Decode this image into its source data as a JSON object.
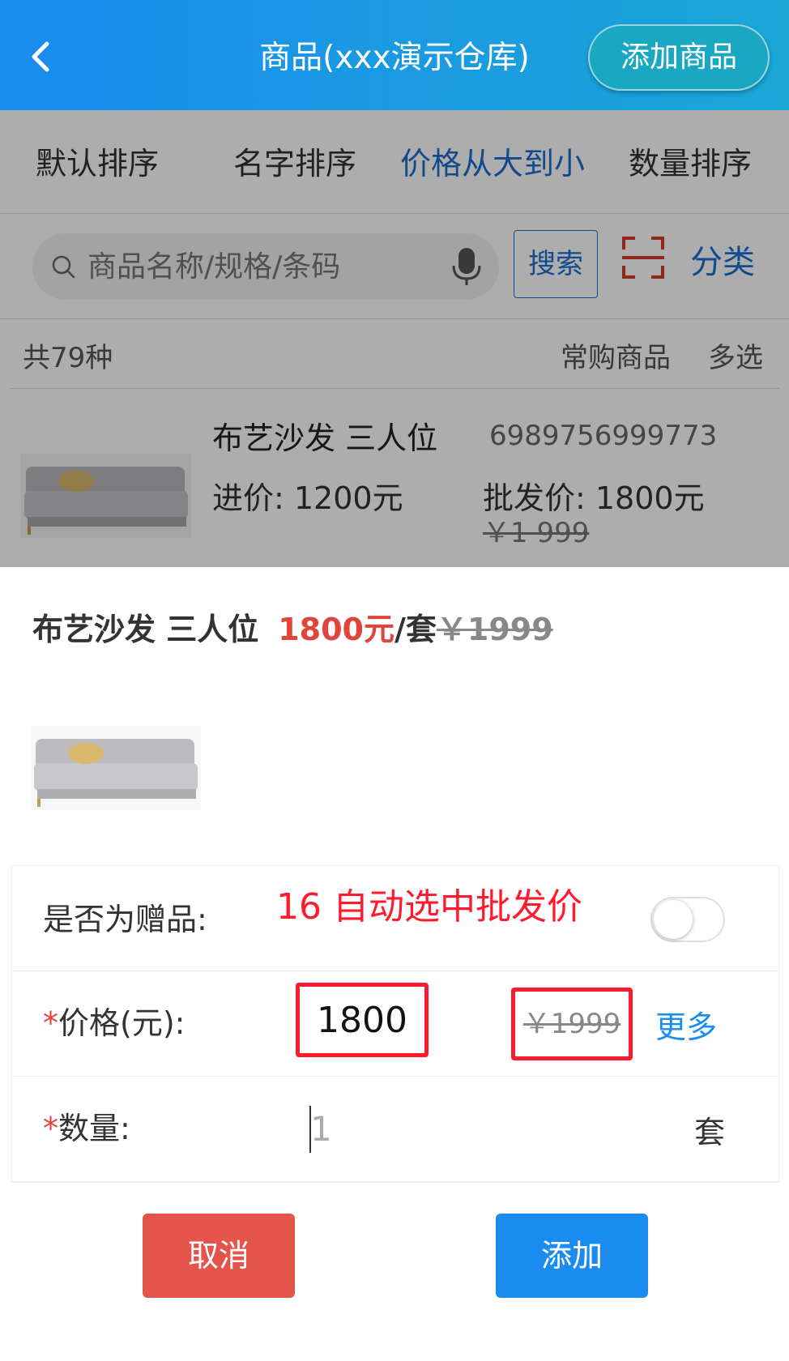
{
  "header": {
    "title": "商品(xxx演示仓库)",
    "add_button": "添加商品"
  },
  "sort_tabs": [
    {
      "label": "默认排序",
      "active": false
    },
    {
      "label": "名字排序",
      "active": false
    },
    {
      "label": "价格从大到小",
      "active": true
    },
    {
      "label": "数量排序",
      "active": false
    }
  ],
  "search": {
    "placeholder": "商品名称/规格/条码",
    "button": "搜索",
    "category": "分类"
  },
  "list_meta": {
    "count": "共79种",
    "often_bought": "常购商品",
    "multi_select": "多选"
  },
  "product": {
    "name": "布艺沙发   三人位",
    "barcode": "6989756999773",
    "cost_price": "进价: 1200元",
    "wholesale_price": "批发价: 1800元",
    "original_price": "￥1 999"
  },
  "popup": {
    "name": "布艺沙发   三人位",
    "price": "1800元",
    "unit_suffix": "/套",
    "original_price": "￥1999",
    "annotation": "16 自动选中批发价",
    "gift_label": "是否为赠品:",
    "gift_enabled": false,
    "price_label": "价格(元):",
    "price_value": "1800",
    "price_original": "￥1999",
    "more": "更多",
    "qty_label": "数量:",
    "qty_placeholder": "1",
    "qty_unit": "套",
    "required_mark": "*",
    "cancel": "取消",
    "add": "添加"
  },
  "colors": {
    "accent_blue": "#1a8cf0",
    "active_sort": "#1a6fd0",
    "price_red": "#e0443b",
    "cancel_red": "#e5544a",
    "annotation_red": "#ff1a2e"
  }
}
